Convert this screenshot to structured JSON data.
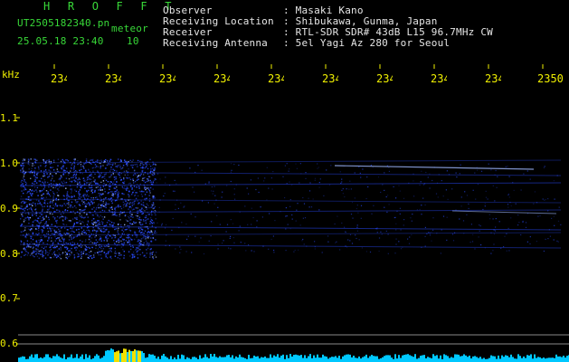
{
  "app_title": "H R O F F T",
  "filename": "UT2505182340.pn",
  "tag": "meteor",
  "datetime": "25.05.18 23:40",
  "count": "10",
  "header": [
    {
      "label": "Observer",
      "value": ": Masaki Kano"
    },
    {
      "label": "Receiving Location",
      "value": ": Shibukawa, Gunma, Japan"
    },
    {
      "label": "Receiver",
      "value": ": RTL-SDR SDR# 43dB L15 96.7MHz CW"
    },
    {
      "label": "Receiving Antenna",
      "value": ": 5el Yagi Az 280 for Seoul"
    }
  ],
  "x_ticks": [
    "234",
    "234",
    "234",
    "234",
    "234",
    "234",
    "234",
    "234",
    "234",
    "2350"
  ],
  "y_unit": "kHz",
  "y_ticks": [
    "1.1",
    "1.0",
    "0.9",
    "0.8",
    "0.7",
    "0.6"
  ],
  "colors": {
    "background": "#000000",
    "axis_text": "#f0f000",
    "title": "#38d838",
    "header_text": "#e6e6e6",
    "signal": "#2a4cff",
    "signal_bright": "#9fb8ff",
    "baseline": "#00c8ff",
    "guide_line": "#8a8a8a"
  },
  "chart_data": {
    "type": "heatmap",
    "xlabel": "",
    "ylabel": "kHz",
    "ylim": [
      0.58,
      1.14
    ],
    "x": [
      "234",
      "234",
      "234",
      "234",
      "234",
      "234",
      "234",
      "234",
      "234",
      "2350"
    ],
    "y": [
      1.1,
      1.0,
      0.9,
      0.8,
      0.7,
      0.6
    ],
    "series": [
      {
        "values": [
          1.0,
          0.98,
          0.95,
          0.92,
          0.89,
          0.86,
          0.84,
          0.82
        ]
      }
    ]
  }
}
